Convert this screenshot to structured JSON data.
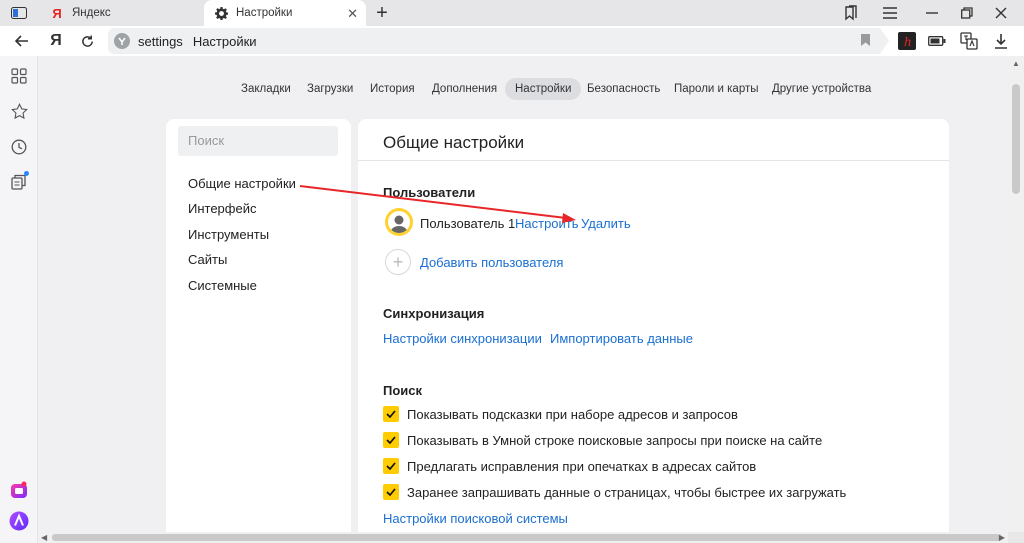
{
  "tabs": [
    {
      "label": "Яндекс",
      "icon": "yandex-logo-icon"
    },
    {
      "label": "Настройки",
      "icon": "gear-icon"
    }
  ],
  "address": {
    "host": "settings",
    "title": "Настройки"
  },
  "topnav": [
    "Закладки",
    "Загрузки",
    "История",
    "Дополнения",
    "Настройки",
    "Безопасность",
    "Пароли и карты",
    "Другие устройства"
  ],
  "topnav_active": "Настройки",
  "left_panel": {
    "search_placeholder": "Поиск",
    "items": [
      "Общие настройки",
      "Интерфейс",
      "Инструменты",
      "Сайты",
      "Системные"
    ]
  },
  "main": {
    "title": "Общие настройки",
    "users": {
      "title": "Пользователи",
      "user_name": "Пользователь 1",
      "configure": "Настроить",
      "delete": "Удалить",
      "add_user": "Добавить пользователя"
    },
    "sync": {
      "title": "Синхронизация",
      "sync_settings": "Настройки синхронизации",
      "import": "Импортировать данные"
    },
    "search": {
      "title": "Поиск",
      "options": [
        "Показывать подсказки при наборе адресов и запросов",
        "Показывать в Умной строке поисковые запросы при поиске на сайте",
        "Предлагать исправления при опечатках в адресах сайтов",
        "Заранее запрашивать данные о страницах, чтобы быстрее их загружать"
      ],
      "engine_settings": "Настройки поисковой системы"
    }
  },
  "colors": {
    "accent_link": "#1a6fd1",
    "checkbox": "#ffcc00",
    "arrow": "#e8262a",
    "avatar_ring": "#ffd12e"
  }
}
